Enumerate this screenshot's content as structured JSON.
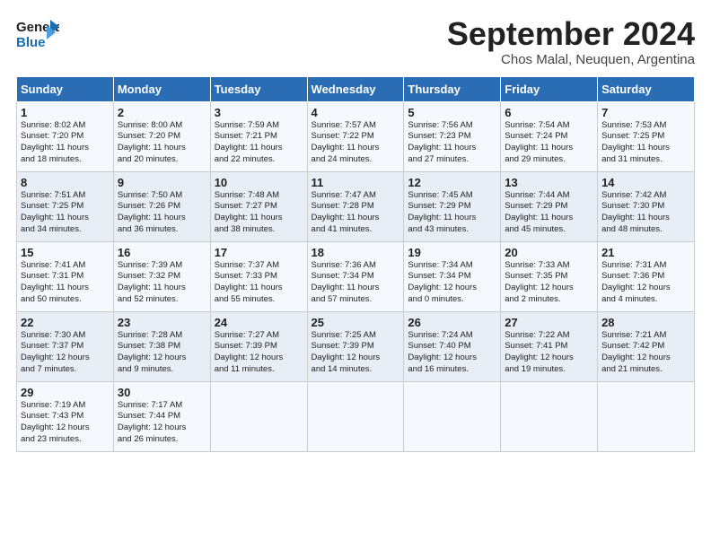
{
  "header": {
    "logo_general": "General",
    "logo_blue": "Blue",
    "month_title": "September 2024",
    "subtitle": "Chos Malal, Neuquen, Argentina"
  },
  "days_of_week": [
    "Sunday",
    "Monday",
    "Tuesday",
    "Wednesday",
    "Thursday",
    "Friday",
    "Saturday"
  ],
  "weeks": [
    [
      {
        "day": "1",
        "info": "Sunrise: 8:02 AM\nSunset: 7:20 PM\nDaylight: 11 hours\nand 18 minutes."
      },
      {
        "day": "2",
        "info": "Sunrise: 8:00 AM\nSunset: 7:20 PM\nDaylight: 11 hours\nand 20 minutes."
      },
      {
        "day": "3",
        "info": "Sunrise: 7:59 AM\nSunset: 7:21 PM\nDaylight: 11 hours\nand 22 minutes."
      },
      {
        "day": "4",
        "info": "Sunrise: 7:57 AM\nSunset: 7:22 PM\nDaylight: 11 hours\nand 24 minutes."
      },
      {
        "day": "5",
        "info": "Sunrise: 7:56 AM\nSunset: 7:23 PM\nDaylight: 11 hours\nand 27 minutes."
      },
      {
        "day": "6",
        "info": "Sunrise: 7:54 AM\nSunset: 7:24 PM\nDaylight: 11 hours\nand 29 minutes."
      },
      {
        "day": "7",
        "info": "Sunrise: 7:53 AM\nSunset: 7:25 PM\nDaylight: 11 hours\nand 31 minutes."
      }
    ],
    [
      {
        "day": "8",
        "info": "Sunrise: 7:51 AM\nSunset: 7:25 PM\nDaylight: 11 hours\nand 34 minutes."
      },
      {
        "day": "9",
        "info": "Sunrise: 7:50 AM\nSunset: 7:26 PM\nDaylight: 11 hours\nand 36 minutes."
      },
      {
        "day": "10",
        "info": "Sunrise: 7:48 AM\nSunset: 7:27 PM\nDaylight: 11 hours\nand 38 minutes."
      },
      {
        "day": "11",
        "info": "Sunrise: 7:47 AM\nSunset: 7:28 PM\nDaylight: 11 hours\nand 41 minutes."
      },
      {
        "day": "12",
        "info": "Sunrise: 7:45 AM\nSunset: 7:29 PM\nDaylight: 11 hours\nand 43 minutes."
      },
      {
        "day": "13",
        "info": "Sunrise: 7:44 AM\nSunset: 7:29 PM\nDaylight: 11 hours\nand 45 minutes."
      },
      {
        "day": "14",
        "info": "Sunrise: 7:42 AM\nSunset: 7:30 PM\nDaylight: 11 hours\nand 48 minutes."
      }
    ],
    [
      {
        "day": "15",
        "info": "Sunrise: 7:41 AM\nSunset: 7:31 PM\nDaylight: 11 hours\nand 50 minutes."
      },
      {
        "day": "16",
        "info": "Sunrise: 7:39 AM\nSunset: 7:32 PM\nDaylight: 11 hours\nand 52 minutes."
      },
      {
        "day": "17",
        "info": "Sunrise: 7:37 AM\nSunset: 7:33 PM\nDaylight: 11 hours\nand 55 minutes."
      },
      {
        "day": "18",
        "info": "Sunrise: 7:36 AM\nSunset: 7:34 PM\nDaylight: 11 hours\nand 57 minutes."
      },
      {
        "day": "19",
        "info": "Sunrise: 7:34 AM\nSunset: 7:34 PM\nDaylight: 12 hours\nand 0 minutes."
      },
      {
        "day": "20",
        "info": "Sunrise: 7:33 AM\nSunset: 7:35 PM\nDaylight: 12 hours\nand 2 minutes."
      },
      {
        "day": "21",
        "info": "Sunrise: 7:31 AM\nSunset: 7:36 PM\nDaylight: 12 hours\nand 4 minutes."
      }
    ],
    [
      {
        "day": "22",
        "info": "Sunrise: 7:30 AM\nSunset: 7:37 PM\nDaylight: 12 hours\nand 7 minutes."
      },
      {
        "day": "23",
        "info": "Sunrise: 7:28 AM\nSunset: 7:38 PM\nDaylight: 12 hours\nand 9 minutes."
      },
      {
        "day": "24",
        "info": "Sunrise: 7:27 AM\nSunset: 7:39 PM\nDaylight: 12 hours\nand 11 minutes."
      },
      {
        "day": "25",
        "info": "Sunrise: 7:25 AM\nSunset: 7:39 PM\nDaylight: 12 hours\nand 14 minutes."
      },
      {
        "day": "26",
        "info": "Sunrise: 7:24 AM\nSunset: 7:40 PM\nDaylight: 12 hours\nand 16 minutes."
      },
      {
        "day": "27",
        "info": "Sunrise: 7:22 AM\nSunset: 7:41 PM\nDaylight: 12 hours\nand 19 minutes."
      },
      {
        "day": "28",
        "info": "Sunrise: 7:21 AM\nSunset: 7:42 PM\nDaylight: 12 hours\nand 21 minutes."
      }
    ],
    [
      {
        "day": "29",
        "info": "Sunrise: 7:19 AM\nSunset: 7:43 PM\nDaylight: 12 hours\nand 23 minutes."
      },
      {
        "day": "30",
        "info": "Sunrise: 7:17 AM\nSunset: 7:44 PM\nDaylight: 12 hours\nand 26 minutes."
      },
      {
        "day": "",
        "info": ""
      },
      {
        "day": "",
        "info": ""
      },
      {
        "day": "",
        "info": ""
      },
      {
        "day": "",
        "info": ""
      },
      {
        "day": "",
        "info": ""
      }
    ]
  ]
}
